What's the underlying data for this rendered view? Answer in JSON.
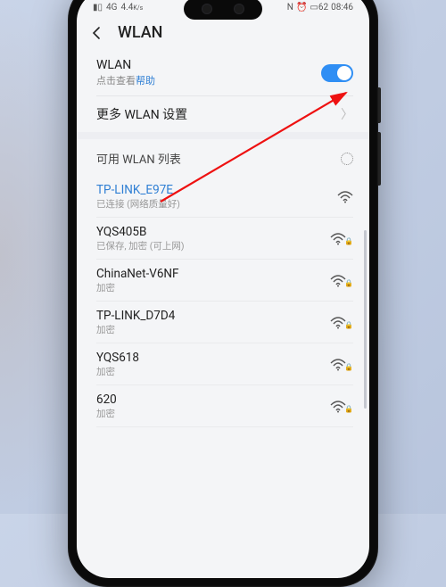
{
  "statusbar": {
    "signal_text": "4G",
    "speed": "4.4",
    "speed_unit": "K/s",
    "nfc": "N",
    "alarm": "⏰",
    "battery": "62",
    "time": "08:46"
  },
  "header": {
    "title": "WLAN"
  },
  "wlan": {
    "label": "WLAN",
    "help_prefix": "点击查看",
    "help_link": "帮助",
    "enabled": true
  },
  "more": {
    "label": "更多 WLAN 设置"
  },
  "available": {
    "heading": "可用 WLAN 列表"
  },
  "networks": [
    {
      "ssid": "TP-LINK_E97E",
      "status": "已连接 (网络质量好)",
      "connected": true,
      "locked": false
    },
    {
      "ssid": "YQS405B",
      "status": "已保存, 加密 (可上网)",
      "connected": false,
      "locked": true
    },
    {
      "ssid": "ChinaNet-V6NF",
      "status": "加密",
      "connected": false,
      "locked": true
    },
    {
      "ssid": "TP-LINK_D7D4",
      "status": "加密",
      "connected": false,
      "locked": true
    },
    {
      "ssid": "YQS618",
      "status": "加密",
      "connected": false,
      "locked": true
    },
    {
      "ssid": "620",
      "status": "加密",
      "connected": false,
      "locked": true
    }
  ]
}
